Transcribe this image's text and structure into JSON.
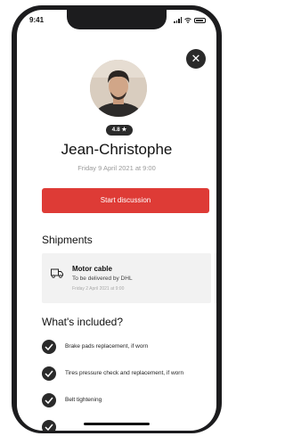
{
  "status_bar": {
    "time": "9:41"
  },
  "profile": {
    "rating": "4.8 ★",
    "name": "Jean-Christophe",
    "date": "Friday 9 April 2021 at 9:00"
  },
  "actions": {
    "start_label": "Start discussion"
  },
  "shipments": {
    "title": "Shipments",
    "items": [
      {
        "title": "Motor cable",
        "subtitle": "To be delivered by DHL",
        "date": "Friday 2 April 2021 at 9:00",
        "icon": "package-icon"
      }
    ]
  },
  "included": {
    "title": "What's included?",
    "items": [
      {
        "label": "Brake pads replacement, if worn"
      },
      {
        "label": "Tires pressure check and replacement, if worn"
      },
      {
        "label": "Belt tightening"
      },
      {
        "label": ""
      }
    ]
  },
  "colors": {
    "accent": "#de3b36",
    "dark": "#2a2a2a"
  }
}
